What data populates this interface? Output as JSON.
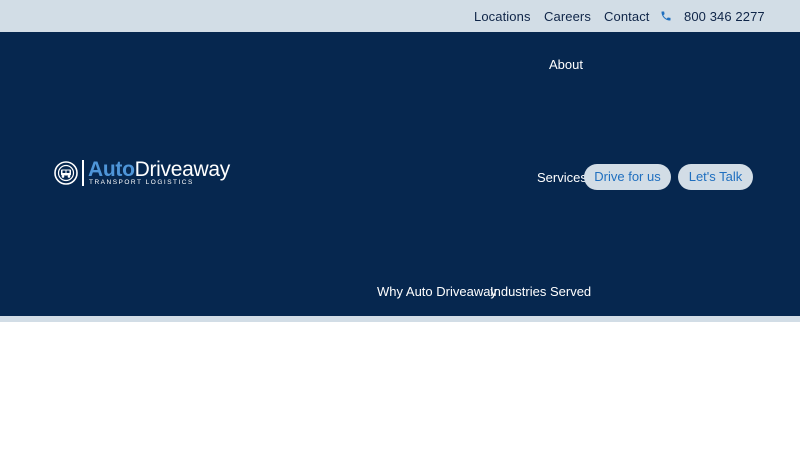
{
  "topbar": {
    "links": {
      "locations": "Locations",
      "careers": "Careers",
      "contact": "Contact"
    },
    "phone": "800 346 2277",
    "phone_icon": "phone-icon"
  },
  "logo": {
    "word_auto": "Auto",
    "word_driveaway": "Driveaway",
    "tagline": "TRANSPORT LOGISTICS",
    "emblem_icon": "truck-emblem-icon"
  },
  "nav": {
    "about": "About",
    "services": "Services",
    "why": "Why Auto Driveaway",
    "industries": "Industries Served"
  },
  "cta": {
    "drive_for_us": "Drive for us",
    "lets_talk": "Let's Talk"
  },
  "colors": {
    "navy": "#06274f",
    "light_blue_gray": "#d2dde6",
    "accent_blue": "#1f6fbf",
    "logo_blue": "#4e95d8"
  }
}
